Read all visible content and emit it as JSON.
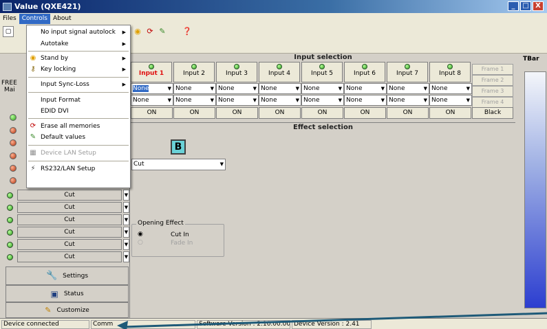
{
  "window": {
    "title": "Value (QXE421)",
    "min": "_",
    "max": "□",
    "close": "X"
  },
  "menubar": {
    "items": [
      "Files",
      "Controls",
      "About"
    ]
  },
  "controls_menu": {
    "items": [
      {
        "label": "No input signal autolock",
        "submenu": true
      },
      {
        "label": "Autotake",
        "submenu": true
      },
      {
        "label": "Stand by",
        "submenu": true,
        "icon": "standby-icon"
      },
      {
        "label": "Key locking",
        "submenu": true,
        "icon": "key-icon"
      },
      {
        "label": "Input Sync-Loss",
        "submenu": true
      },
      {
        "label": "Input Format"
      },
      {
        "label": "EDID DVI"
      },
      {
        "label": "Erase all memories",
        "icon": "erase-icon"
      },
      {
        "label": "Default values",
        "icon": "default-icon"
      },
      {
        "label": "Device LAN Setup",
        "disabled": true,
        "icon": "lan-icon"
      },
      {
        "label": "RS232/LAN Setup",
        "icon": "rs232-icon"
      }
    ]
  },
  "left_panel": {
    "free_label": "FREE",
    "mai_label": "Mai",
    "cut_label": "Cut",
    "settings_label": "Settings",
    "status_label": "Status",
    "customize_label": "Customize"
  },
  "input_selection": {
    "title": "Input selection",
    "inputs": [
      "Input 1",
      "Input 2",
      "Input 3",
      "Input 4",
      "Input 5",
      "Input 6",
      "Input 7",
      "Input 8"
    ],
    "selected": "Input 1",
    "row1": [
      "None",
      "None",
      "None",
      "None",
      "None",
      "None",
      "None",
      "None"
    ],
    "row2": [
      "None",
      "None",
      "None",
      "None",
      "None",
      "None",
      "None",
      "None"
    ],
    "on_label": "ON",
    "frames": [
      "Frame 1",
      "Frame 2",
      "Frame 3",
      "Frame 4"
    ],
    "black_label": "Black"
  },
  "effect_selection": {
    "title": "Effect selection",
    "b_label": "B",
    "effect_value": "Cut",
    "opening_effect_title": "Opening Effect",
    "options": [
      "Cut In",
      "Fade In"
    ]
  },
  "tbar": {
    "label": "TBar"
  },
  "status_bar": {
    "connection": "Device connected",
    "comm": "Comm",
    "software": "Software Version : 2.10.00.00",
    "device": "Device Version : 2.41"
  }
}
